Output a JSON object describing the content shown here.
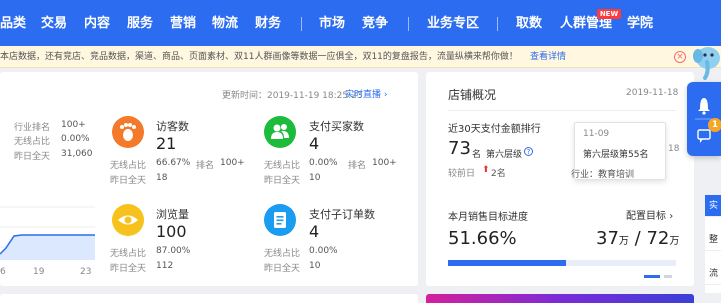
{
  "nav": {
    "items": [
      "品类",
      "交易",
      "内容",
      "服务",
      "营销",
      "物流",
      "财务",
      "市场",
      "竞争",
      "业务专区",
      "取数",
      "人群管理",
      "学院"
    ],
    "new_badge": "NEW"
  },
  "notice": {
    "text": "本店数据，还有竞店、竞品数据，渠道、商品、页面素材、双11人群画像等数据一应俱全，双11的复盘报告，流量纵横来帮你做！",
    "link": "查看详情",
    "close": "×"
  },
  "realtime": {
    "update_time": "更新时间：2019-11-19 18:25:23",
    "live_link": "实时直播",
    "left_stats": [
      {
        "label": "行业排名",
        "value": "100+"
      },
      {
        "label": "无线占比",
        "value": "0.00%"
      },
      {
        "label": "昨日全天",
        "value": "31,060"
      }
    ],
    "chart_ticks": [
      "6",
      "19",
      "23"
    ],
    "metrics": [
      {
        "title": "访客数",
        "value": "21",
        "sub1_label": "无线占比",
        "sub1_value": "66.67%",
        "rank_label": "排名",
        "rank_value": "100+",
        "sub2_label": "昨日全天",
        "sub2_value": "18"
      },
      {
        "title": "支付买家数",
        "value": "4",
        "sub1_label": "无线占比",
        "sub1_value": "0.00%",
        "rank_label": "排名",
        "rank_value": "100+",
        "sub2_label": "昨日全天",
        "sub2_value": "10"
      },
      {
        "title": "浏览量",
        "value": "100",
        "sub1_label": "无线占比",
        "sub1_value": "87.00%",
        "sub2_label": "昨日全天",
        "sub2_value": "112"
      },
      {
        "title": "支付子订单数",
        "value": "4",
        "sub1_label": "无线占比",
        "sub1_value": "0.00%",
        "sub2_label": "昨日全天",
        "sub2_value": "10"
      }
    ],
    "colors": {
      "orange": "#f5792a",
      "green": "#1dbb3c",
      "yellow": "#f7c21b",
      "blue": "#1a9cf0"
    }
  },
  "overview": {
    "title": "店铺概况",
    "date": "2019-11-18",
    "rank_title": "近30天支付金额排行",
    "rank_value": "73",
    "rank_unit": "名",
    "level": "第六层级",
    "compare_label": "较前日",
    "compare_value": "2名",
    "sales_title": "本月销售目标进度",
    "config_link": "配置目标",
    "progress_pct": "51.66%",
    "progress_value": 0.5166,
    "current": "37",
    "current_unit": "万",
    "separator": "/",
    "target": "72",
    "target_unit": "万",
    "peek_date": "1",
    "peek_date2": "18"
  },
  "tooltip": {
    "date": "11-09",
    "level": "第六层级第55名",
    "industry": "行业：教育培训"
  },
  "side": {
    "rows": [
      "实",
      "整",
      "流"
    ],
    "badge": "1"
  }
}
